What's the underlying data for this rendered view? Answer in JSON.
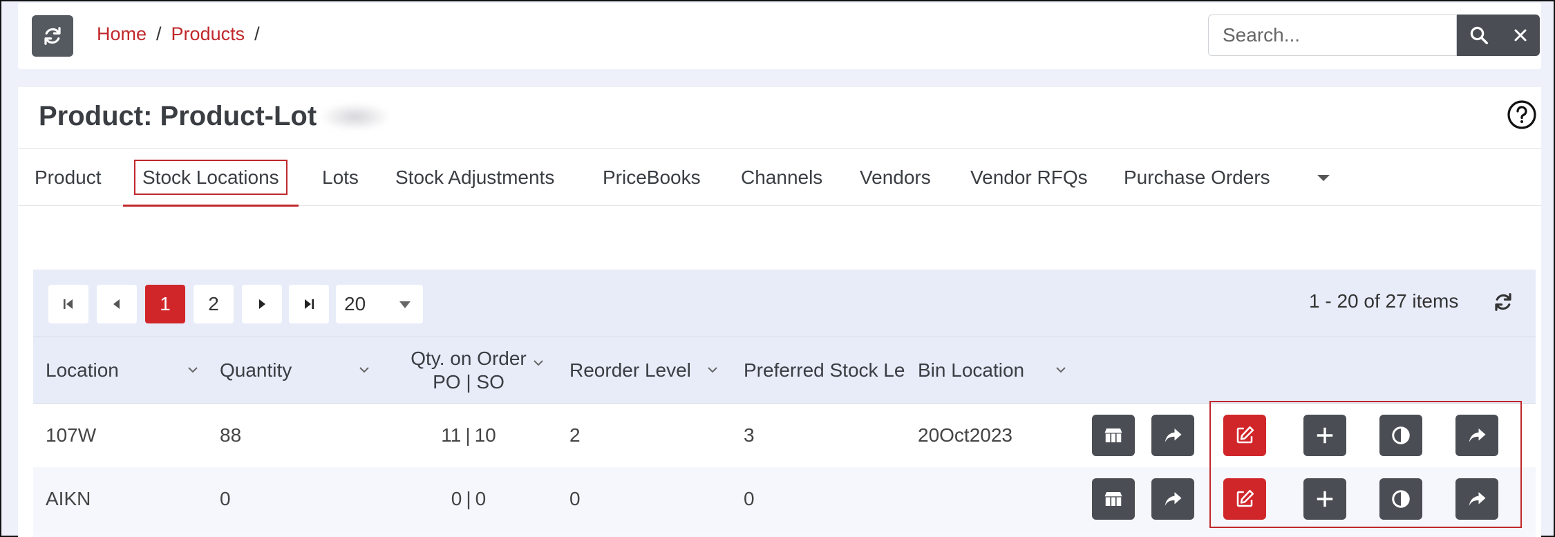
{
  "breadcrumb": {
    "home": "Home",
    "products": "Products",
    "sep": "/"
  },
  "search": {
    "placeholder": "Search..."
  },
  "page": {
    "title": "Product: Product-Lot"
  },
  "tabs": [
    "Product",
    "Stock Locations",
    "Lots",
    "Stock Adjustments",
    "PriceBooks",
    "Channels",
    "Vendors",
    "Vendor RFQs",
    "Purchase Orders"
  ],
  "active_tab": "Stock Locations",
  "pager": {
    "pages": [
      "1",
      "2"
    ],
    "current_page": "1",
    "page_size": "20",
    "info": "1 - 20 of 27 items"
  },
  "columns": {
    "location": "Location",
    "quantity": "Quantity",
    "qty_on_order_line1": "Qty. on Order",
    "qty_on_order_line2": "PO | SO",
    "reorder_level": "Reorder Level",
    "preferred_stock": "Preferred Stock Le",
    "bin_location": "Bin Location"
  },
  "rows": [
    {
      "location": "107W",
      "quantity": "88",
      "po": "11",
      "so": "10",
      "reorder_level": "2",
      "preferred_stock": "3",
      "bin_location": "20Oct2023"
    },
    {
      "location": "AIKN",
      "quantity": "0",
      "po": "0",
      "so": "0",
      "reorder_level": "0",
      "preferred_stock": "0",
      "bin_location": ""
    }
  ],
  "icons": {
    "refresh": "refresh-icon",
    "search": "search-icon",
    "close": "close-icon",
    "help": "help-icon",
    "first": "first-page-icon",
    "prev": "prev-page-icon",
    "next": "next-page-icon",
    "last": "last-page-icon",
    "row_actions": [
      "warehouse-icon",
      "share-icon",
      "edit-icon",
      "plus-icon",
      "adjust-icon",
      "share-icon"
    ]
  },
  "colors": {
    "accent": "#c0282b",
    "dark_button": "#4a4e54",
    "header_bg": "#e8ecf9"
  }
}
